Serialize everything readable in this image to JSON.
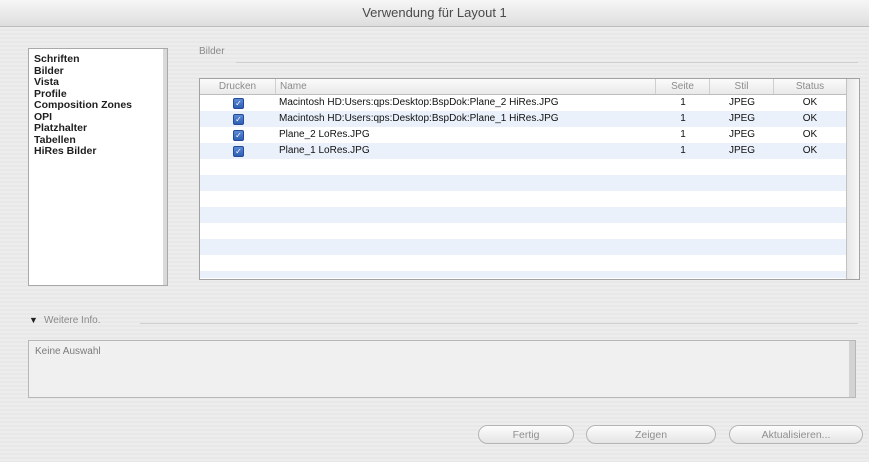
{
  "window": {
    "title": "Verwendung für Layout 1"
  },
  "sidebar": {
    "items": [
      {
        "label": "Schriften"
      },
      {
        "label": "Bilder"
      },
      {
        "label": "Vista"
      },
      {
        "label": "Profile"
      },
      {
        "label": "Composition Zones"
      },
      {
        "label": "OPI"
      },
      {
        "label": "Platzhalter"
      },
      {
        "label": "Tabellen"
      },
      {
        "label": "HiRes Bilder"
      }
    ]
  },
  "images_group": {
    "label": "Bilder"
  },
  "table": {
    "columns": {
      "print": "Drucken",
      "name": "Name",
      "page": "Seite",
      "style": "Stil",
      "status": "Status"
    },
    "rows": [
      {
        "checked": true,
        "name": "Macintosh HD:Users:qps:Desktop:BspDok:Plane_2 HiRes.JPG",
        "page": "1",
        "style": "JPEG",
        "status": "OK"
      },
      {
        "checked": true,
        "name": "Macintosh HD:Users:qps:Desktop:BspDok:Plane_1 HiRes.JPG",
        "page": "1",
        "style": "JPEG",
        "status": "OK"
      },
      {
        "checked": true,
        "name": "Plane_2 LoRes.JPG",
        "page": "1",
        "style": "JPEG",
        "status": "OK"
      },
      {
        "checked": true,
        "name": "Plane_1 LoRes.JPG",
        "page": "1",
        "style": "JPEG",
        "status": "OK"
      }
    ]
  },
  "more_info": {
    "label": "Weitere Info.",
    "disclosure_glyph": "▼",
    "empty_text": "Keine Auswahl"
  },
  "buttons": {
    "done": "Fertig",
    "show": "Zeigen",
    "update": "Aktualisieren..."
  },
  "icons": {
    "checkbox": "checkbox-checked-icon",
    "disclosure": "disclosure-triangle-icon"
  },
  "colors": {
    "accent": "#3a6bc4",
    "stripe": "#eaf1fb"
  }
}
